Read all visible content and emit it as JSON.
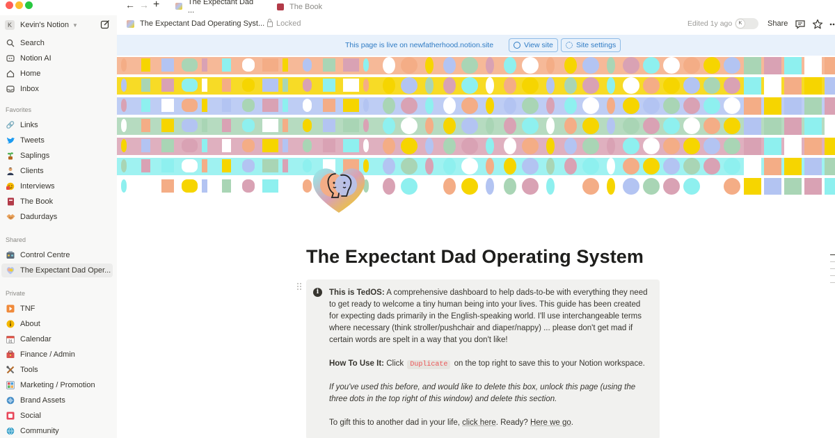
{
  "tabs": {
    "active": "The Expectant Dad ...",
    "inactive": "The Book"
  },
  "sidebar": {
    "workspace": "Kevin's Notion",
    "workspace_initial": "K",
    "top_items": [
      {
        "label": "Search",
        "icon": "search-icon"
      },
      {
        "label": "Notion AI",
        "icon": "notion-ai-icon"
      },
      {
        "label": "Home",
        "icon": "home-icon"
      },
      {
        "label": "Inbox",
        "icon": "inbox-icon"
      }
    ],
    "favorites_heading": "Favorites",
    "favorites": [
      {
        "label": "Links",
        "icon": "link-icon"
      },
      {
        "label": "Tweets",
        "icon": "bird-icon"
      },
      {
        "label": "Saplings",
        "icon": "sapling-icon"
      },
      {
        "label": "Clients",
        "icon": "person-icon"
      },
      {
        "label": "Interviews",
        "icon": "chat-icon"
      },
      {
        "label": "The Book",
        "icon": "book-icon"
      },
      {
        "label": "Dadurdays",
        "icon": "handshake-icon"
      }
    ],
    "shared_heading": "Shared",
    "shared": [
      {
        "label": "Control Centre",
        "icon": "control-icon"
      },
      {
        "label": "The Expectant Dad Oper...",
        "icon": "brain-icon"
      }
    ],
    "private_heading": "Private",
    "private": [
      {
        "label": "TNF",
        "icon": "play-icon"
      },
      {
        "label": "About",
        "icon": "info-icon"
      },
      {
        "label": "Calendar",
        "icon": "calendar-icon"
      },
      {
        "label": "Finance / Admin",
        "icon": "finance-icon"
      },
      {
        "label": "Tools",
        "icon": "tools-icon"
      },
      {
        "label": "Marketing / Promotion",
        "icon": "marketing-icon"
      },
      {
        "label": "Brand Assets",
        "icon": "brand-icon"
      },
      {
        "label": "Social",
        "icon": "social-icon"
      },
      {
        "label": "Community",
        "icon": "community-icon"
      }
    ]
  },
  "topbar": {
    "breadcrumb": "The Expectant Dad Operating Syst...",
    "locked": "Locked",
    "edited": "Edited 1y ago",
    "avatar": "K",
    "share": "Share"
  },
  "banner": {
    "text": "This page is live on newfatherhood.notion.site",
    "view_site": "View site",
    "site_settings": "Site settings"
  },
  "page": {
    "title": "The Expectant Dad Operating System",
    "callout": {
      "intro_bold": "This is TedOS:",
      "intro": " A comprehensive dashboard to help dads-to-be with everything they need to get ready to welcome a tiny human being into your lives. This guide has been created for expecting dads primarily in the English-speaking world. I'll use interchangeable terms where necessary (think stroller/pushchair and diaper/nappy) ... please don't get mad if certain words are spelt in a way that you don't like!",
      "howto_bold": "How To Use It:",
      "howto_pre": " Click",
      "howto_code": "Duplicate",
      "howto_post": "on the top right to save this to your Notion workspace.",
      "italic": "If you've used this before, and would like to delete this box, unlock this page (using the three dots in the top right of this window) and delete this section.",
      "gift_pre": "To gift this to another dad in your life,",
      "gift_link1": "click here",
      "gift_mid": ". Ready?",
      "gift_link2": "Here we go",
      "gift_end": "."
    }
  },
  "colors": {
    "orange": "#f4ad86",
    "yellow": "#f6d500",
    "blue": "#b3c4f2",
    "green": "#a9d5b5",
    "pink": "#d9a2b4",
    "cyan": "#8ef0ef",
    "grey": "#d7d7d4",
    "banner_blue": "#2e7bc4"
  }
}
